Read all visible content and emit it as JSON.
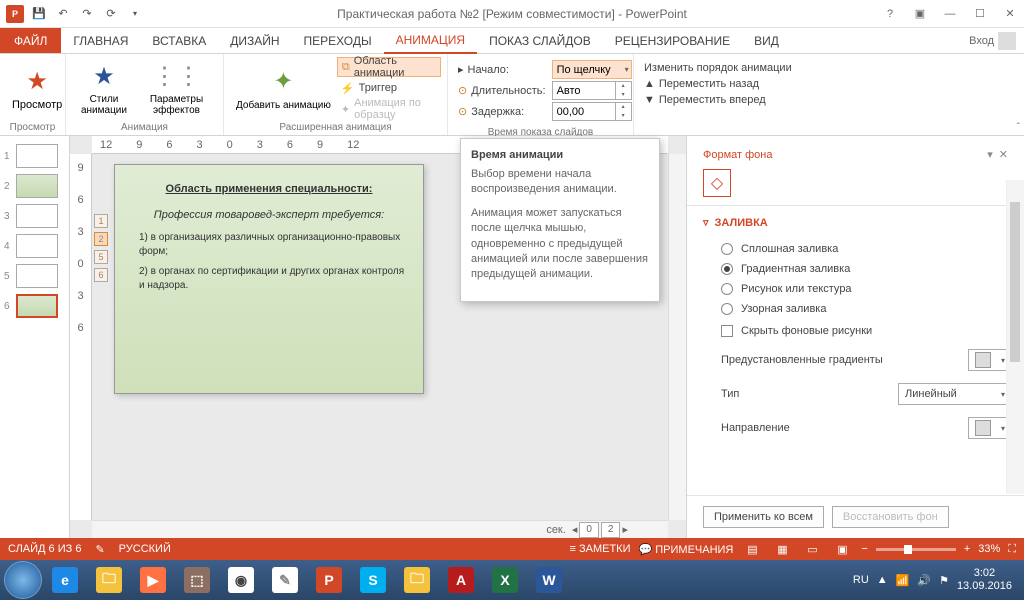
{
  "title": "Практическая работа №2 [Режим совместимости] - PowerPoint",
  "login": "Вход",
  "tabs": {
    "file": "ФАЙЛ",
    "home": "ГЛАВНАЯ",
    "insert": "ВСТАВКА",
    "design": "ДИЗАЙН",
    "trans": "ПЕРЕХОДЫ",
    "anim": "АНИМАЦИЯ",
    "show": "ПОКАЗ СЛАЙДОВ",
    "review": "РЕЦЕНЗИРОВАНИЕ",
    "view": "ВИД"
  },
  "ribbon": {
    "preview": "Просмотр",
    "preview_grp": "Просмотр",
    "styles": "Стили анимации",
    "effects": "Параметры эффектов",
    "anim_grp": "Анимация",
    "add": "Добавить анимацию",
    "pane": "Область анимации",
    "trigger": "Триггер",
    "painter": "Анимация по образцу",
    "adv_grp": "Расширенная анимация",
    "start": "Начало:",
    "start_val": "По щелчку",
    "dur": "Длительность:",
    "dur_val": "Авто",
    "delay": "Задержка:",
    "delay_val": "00,00",
    "timing_grp": "Время показа слайдов",
    "reorder": "Изменить порядок анимации",
    "back": "Переместить назад",
    "fwd": "Переместить вперед"
  },
  "tooltip": {
    "title": "Время анимации",
    "p1": "Выбор времени начала воспроизведения анимации.",
    "p2": "Анимация может запускаться после щелчка мышью, одновременно с предыдущей анимацией или после завершения предыдущей анимации."
  },
  "slide": {
    "title": "Область применения специальности:",
    "sub": "Профессия товаровед-эксперт требуется:",
    "li1": "1)  в организациях различных организационно-правовых форм;",
    "li2": "2)  в органах по сертификации и других органах контроля и надзора."
  },
  "rulerH": [
    "12",
    "9",
    "6",
    "3",
    "0",
    "3",
    "6",
    "9",
    "12"
  ],
  "rulerV": [
    "9",
    "6",
    "3",
    "0",
    "3",
    "6"
  ],
  "tags": [
    "1",
    "2",
    "5",
    "6"
  ],
  "sec_label": "сек.",
  "pager": [
    "0",
    "2"
  ],
  "pane": {
    "title": "Формат фона",
    "section": "ЗАЛИВКА",
    "r1": "Сплошная заливка",
    "r2": "Градиентная заливка",
    "r3": "Рисунок или текстура",
    "r4": "Узорная заливка",
    "hide": "Скрыть фоновые рисунки",
    "preset": "Предустановленные градиенты",
    "type": "Тип",
    "type_val": "Линейный",
    "dir": "Направление",
    "apply": "Применить ко всем",
    "restore": "Восстановить фон"
  },
  "status": {
    "slide": "СЛАЙД 6 ИЗ 6",
    "lang": "РУССКИЙ",
    "notes": "ЗАМЕТКИ",
    "comments": "ПРИМЕЧАНИЯ",
    "zoom": "33%"
  },
  "tray": {
    "lang": "RU",
    "time": "3:02",
    "date": "13.09.2016"
  }
}
